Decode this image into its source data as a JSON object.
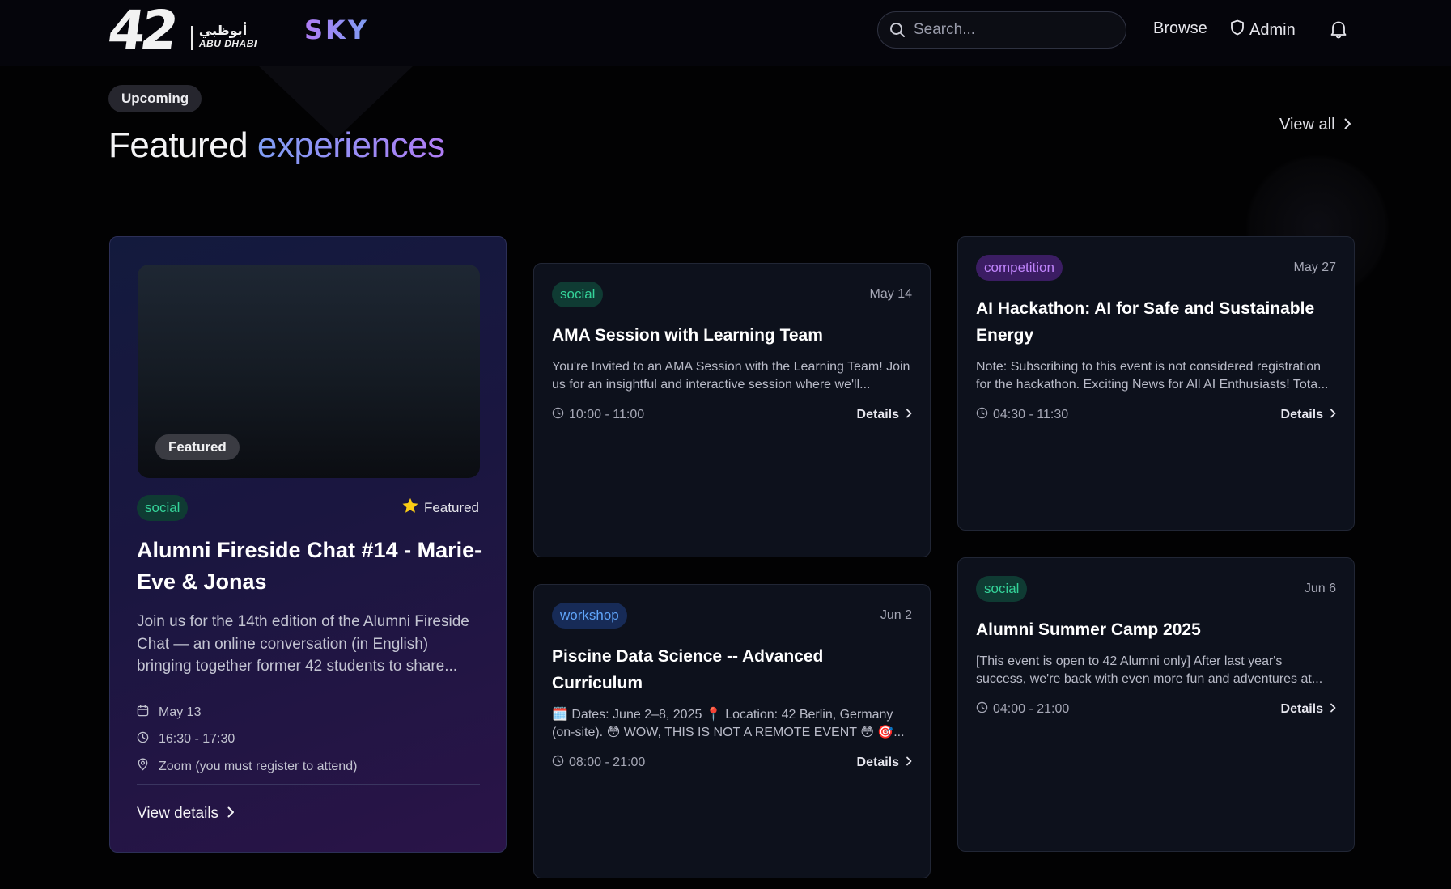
{
  "header": {
    "logo_mark": "42",
    "logo_arabic": "أبوظبي",
    "logo_english": "ABU DHABI",
    "brand": "SKY",
    "search_placeholder": "Search...",
    "nav_browse": "Browse",
    "nav_admin": "Admin",
    "icons": {
      "search": "search-icon",
      "admin": "shield-icon",
      "notifications": "bell-icon"
    }
  },
  "section": {
    "badge": "Upcoming",
    "heading_plain": "Featured",
    "heading_accent": "experiences",
    "view_all": "View all"
  },
  "featured_event": {
    "image_badge": "Featured",
    "category": "social",
    "featured_label": "Featured",
    "title": "Alumni Fireside Chat #14 - Marie-Eve & Jonas",
    "description": "Join us for the 14th edition of the Alumni Fireside Chat — an online conversation (in English) bringing together former 42 students to share...",
    "date": "May 13",
    "time": "16:30 - 17:30",
    "location": "Zoom (you must register to attend)",
    "cta": "View details"
  },
  "events": [
    {
      "category": "social",
      "date": "May 14",
      "title": "AMA Session with Learning Team",
      "description": "You're Invited to an AMA Session with the Learning Team! Join us for an insightful and interactive session where we'll...",
      "time": "10:00 - 11:00",
      "cta": "Details"
    },
    {
      "category": "workshop",
      "date": "Jun 2",
      "title": "Piscine Data Science -- Advanced Curriculum",
      "description": "🗓️ Dates: June 2–8, 2025 📍 Location: 42 Berlin, Germany (on-site). 😳 WOW, THIS IS NOT A REMOTE EVENT 😳 🎯...",
      "time": "08:00 - 21:00",
      "cta": "Details"
    },
    {
      "category": "competition",
      "date": "May 27",
      "title": "AI Hackathon: AI for Safe and Sustainable Energy",
      "description": "Note: Subscribing to this event is not considered registration for the hackathon. Exciting News for All AI Enthusiasts! Tota...",
      "time": "04:30 - 11:30",
      "cta": "Details"
    },
    {
      "category": "social",
      "date": "Jun 6",
      "title": "Alumni Summer Camp 2025",
      "description": "[This event is open to 42 Alumni only] After last year's success, we're back with even more fun and adventures at...",
      "time": "04:00 - 21:00",
      "cta": "Details"
    }
  ],
  "colors": {
    "background": "#020203",
    "card": "#0d111c",
    "social": "#34d399",
    "competition": "#c084fc",
    "workshop": "#60a5fa",
    "star": "#facc15"
  }
}
